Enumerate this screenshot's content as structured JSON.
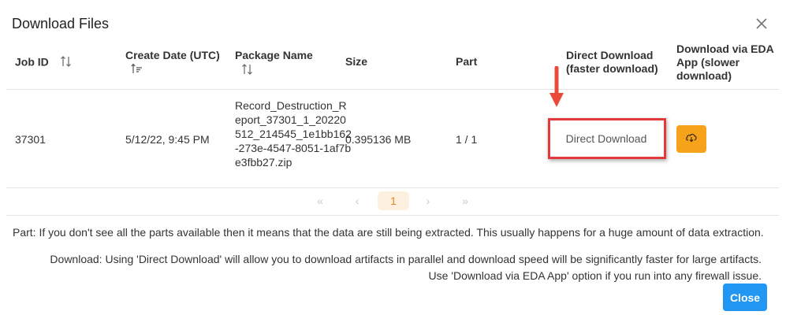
{
  "dialog": {
    "title": "Download Files",
    "close_icon": "close-icon"
  },
  "table": {
    "headers": {
      "job_id": "Job ID",
      "create_date": "Create Date (UTC)",
      "package_name": "Package Name",
      "size": "Size",
      "part": "Part",
      "direct_download_1": "Direct Download",
      "direct_download_2": "(faster download)",
      "eda_1": "Download via EDA",
      "eda_2": "App (slower",
      "eda_3": "download)"
    },
    "rows": [
      {
        "job_id": "37301",
        "create_date": "5/12/22, 9:45 PM",
        "package_name": "Record_Destruction_Report_37301_1_20220512_214545_1e1bb162-273e-4547-8051-1af7be3fbb27.zip",
        "size": "0.395136 MB",
        "part": "1 / 1",
        "direct_download_label": "Direct Download",
        "eda_icon": "cloud-download-icon"
      }
    ]
  },
  "pagination": {
    "first": "«",
    "prev": "‹",
    "current": "1",
    "next": "›",
    "last": "»"
  },
  "notes": {
    "part": "Part: If you don't see all the parts available then it means that the data are still being extracted. This usually happens for a huge amount of data extraction.",
    "download_1": "Download: Using 'Direct Download' will allow you to download artifacts in parallel and download speed will be significantly faster for large artifacts.",
    "download_2": "Use 'Download via EDA App' option if you run into any firewall issue."
  },
  "footer": {
    "close_label": "Close"
  },
  "colors": {
    "accent_orange": "#f7a21b",
    "close_blue": "#2196f3",
    "annotation_red": "#e03a3a"
  }
}
